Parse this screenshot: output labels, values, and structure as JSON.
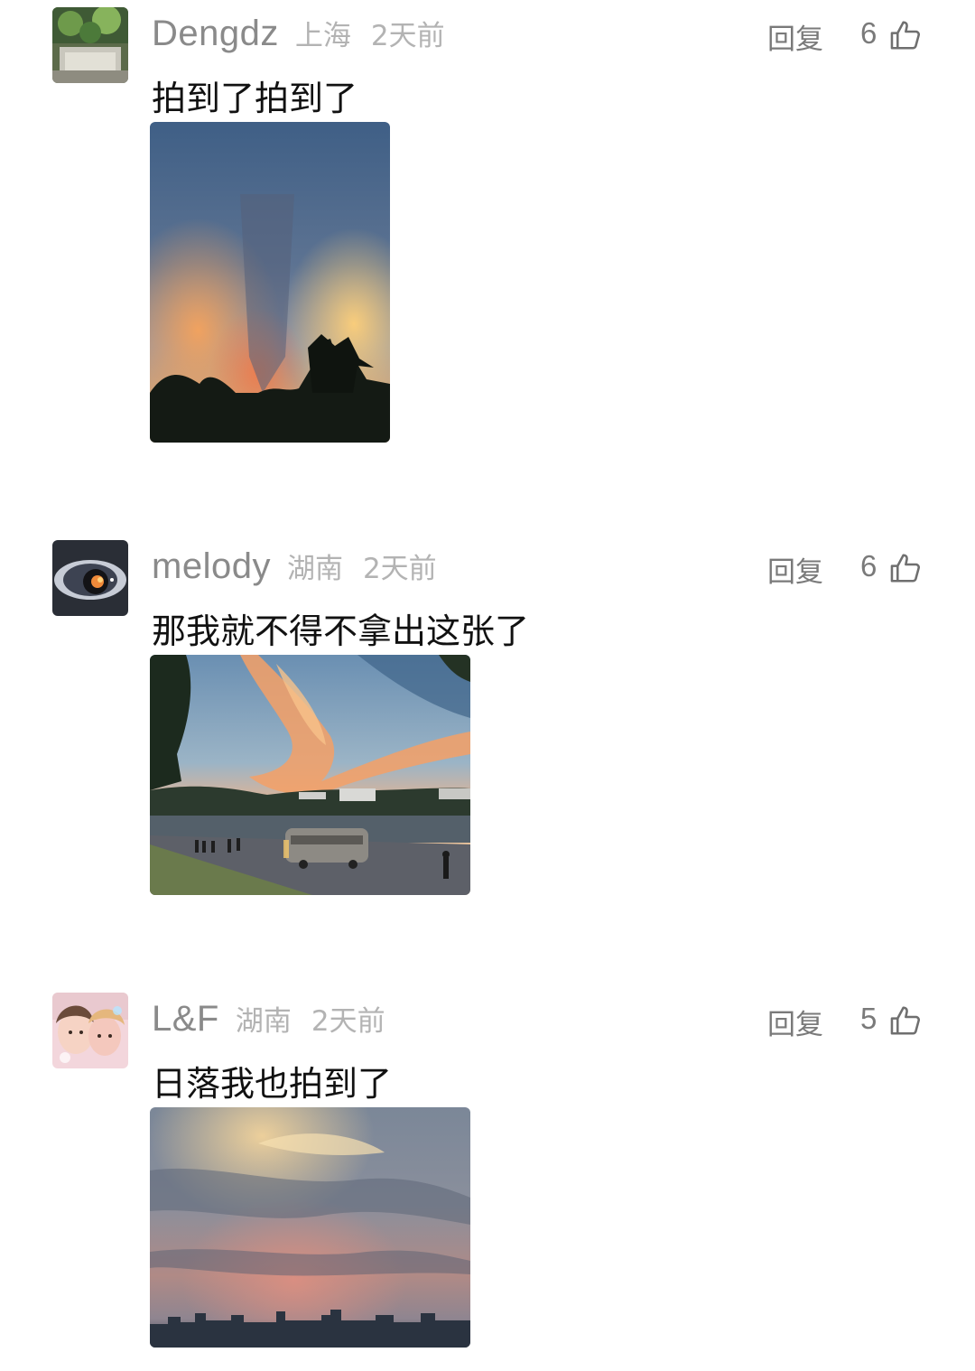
{
  "comments": [
    {
      "username": "Dengdz",
      "location": "上海",
      "time": "2天前",
      "reply": "回复",
      "likes": "6",
      "like_icon": "thumbs-up-icon",
      "text": "拍到了拍到了",
      "photo": "sunset-clouds-over-trees-photo"
    },
    {
      "username": "melody",
      "location": "湖南",
      "time": "2天前",
      "reply": "回复",
      "likes": "6",
      "like_icon": "thumbs-up-icon",
      "text": "那我就不得不拿出这张了",
      "photo": "riverside-sunset-with-bus-photo"
    },
    {
      "username": "L&F",
      "location": "湖南",
      "time": "2天前",
      "reply": "回复",
      "likes": "5",
      "like_icon": "thumbs-up-icon",
      "text": "日落我也拍到了",
      "photo": "dusk-sky-over-city-photo"
    }
  ],
  "colors": {
    "username": "#8a8a8a",
    "meta": "#b3b3b3",
    "action": "#7a7a7a",
    "text": "#111111"
  }
}
